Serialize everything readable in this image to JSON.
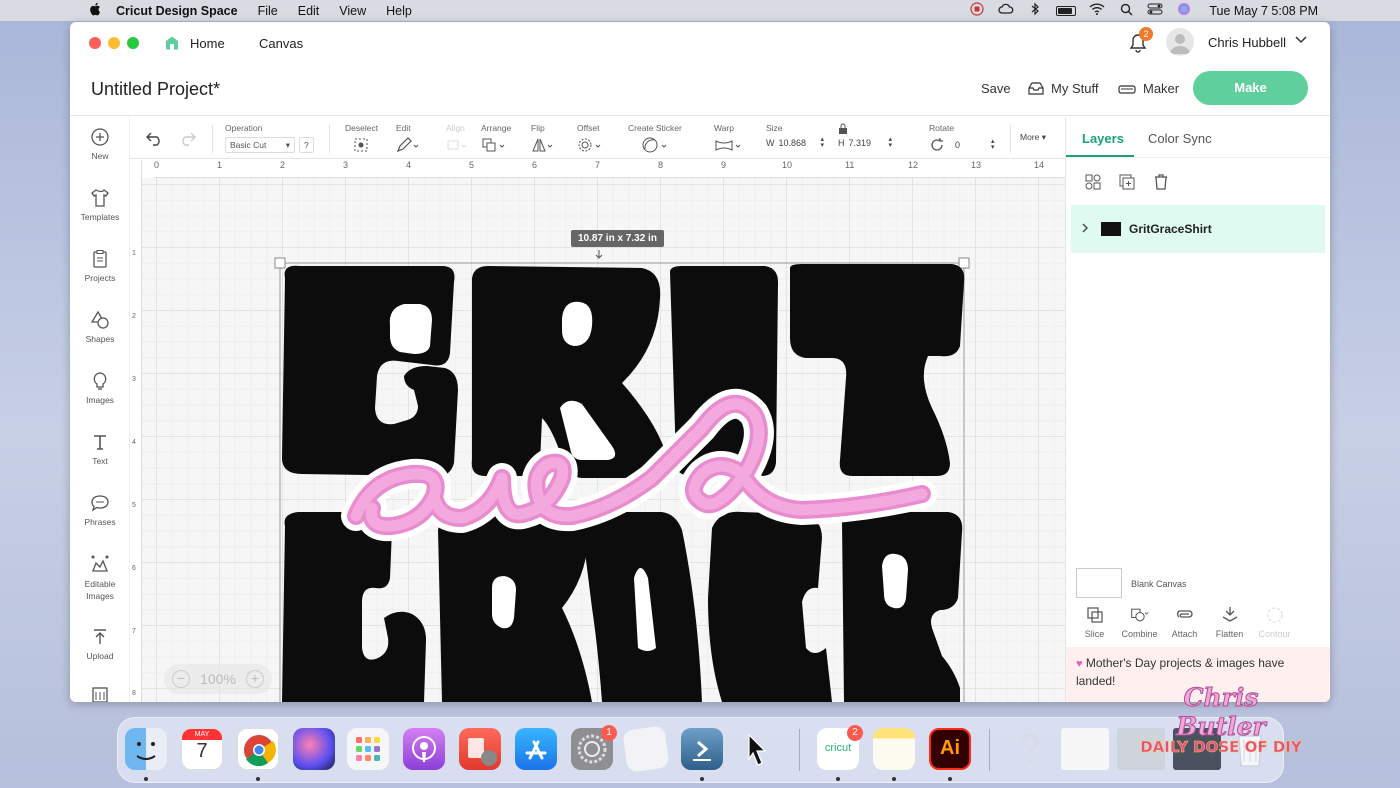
{
  "menubar": {
    "app_name": "Cricut Design Space",
    "menus": [
      "File",
      "Edit",
      "View",
      "Help"
    ],
    "clock": "Tue May 7  5:08 PM"
  },
  "titlebar": {
    "home_label": "Home",
    "canvas_label": "Canvas",
    "notification_count": "2",
    "user_name": "Chris Hubbell"
  },
  "header": {
    "project_title": "Untitled Project*",
    "save_label": "Save",
    "mystuff_label": "My Stuff",
    "maker_label": "Maker",
    "make_label": "Make"
  },
  "left_tools": [
    {
      "label": "New",
      "icon": "plus-circle-icon"
    },
    {
      "label": "Templates",
      "icon": "shirt-icon"
    },
    {
      "label": "Projects",
      "icon": "clipboard-icon"
    },
    {
      "label": "Shapes",
      "icon": "shapes-icon"
    },
    {
      "label": "Images",
      "icon": "lightbulb-icon"
    },
    {
      "label": "Text",
      "icon": "text-icon"
    },
    {
      "label": "Phrases",
      "icon": "speech-bubble-icon"
    },
    {
      "label": "Editable Images",
      "icon": "editable-image-icon"
    },
    {
      "label": "Upload",
      "icon": "upload-icon"
    }
  ],
  "toolbar": {
    "operation_label": "Operation",
    "operation_value": "Basic Cut",
    "help": "?",
    "deselect_label": "Deselect",
    "edit_label": "Edit",
    "align_label": "Align",
    "arrange_label": "Arrange",
    "flip_label": "Flip",
    "offset_label": "Offset",
    "sticker_label": "Create Sticker",
    "warp_label": "Warp",
    "size_label": "Size",
    "w_label": "W",
    "w_value": "10.868",
    "h_label": "H",
    "h_value": "7.319",
    "rotate_label": "Rotate",
    "rotate_value": "0",
    "more_label": "More"
  },
  "ruler": {
    "top": [
      "0",
      "1",
      "2",
      "3",
      "4",
      "5",
      "6",
      "7",
      "8",
      "9",
      "10",
      "11",
      "12",
      "13",
      "14"
    ],
    "left": [
      "1",
      "2",
      "3",
      "4",
      "5",
      "6",
      "7",
      "8"
    ]
  },
  "canvas": {
    "size_tooltip": "10.87  in x 7.32  in",
    "zoom": "100%",
    "design_words": [
      "GRIT",
      "and",
      "GRACE"
    ],
    "colors": {
      "black": "#0c0c0c",
      "pink": "#f4a3dc",
      "pink_dark": "#e98bcf"
    }
  },
  "right_panel": {
    "tab_layers": "Layers",
    "tab_colorsync": "Color Sync",
    "layer_name": "GritGraceShirt",
    "blank_canvas_label": "Blank Canvas",
    "actions": [
      {
        "label": "Slice",
        "icon": "slice-icon",
        "enabled": true
      },
      {
        "label": "Combine",
        "icon": "combine-icon",
        "enabled": true
      },
      {
        "label": "Attach",
        "icon": "attach-icon",
        "enabled": true
      },
      {
        "label": "Flatten",
        "icon": "flatten-icon",
        "enabled": true
      },
      {
        "label": "Contour",
        "icon": "contour-icon",
        "enabled": false
      }
    ],
    "promo_text": "Mother's Day projects & images have landed!",
    "accent": "#1aa37a"
  },
  "dock": {
    "calendar_month": "MAY",
    "calendar_day": "7",
    "settings_badge": "1",
    "cricut_badge": "2",
    "cricut_text": "cricut",
    "ai_text": "Ai"
  },
  "watermark": {
    "line1": "Chris Butler",
    "line2": "DAILY DOSE OF DIY"
  }
}
